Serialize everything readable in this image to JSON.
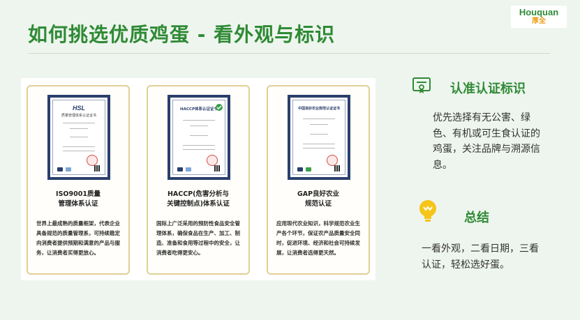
{
  "header": {
    "title": "如何挑选优质鸡蛋 - 看外观与标识",
    "logo_en": "Houquan",
    "logo_cn": "厚全"
  },
  "cards": [
    {
      "cert_logo": "HSL",
      "cert_heading": "质量管理体系认证证书",
      "title": "ISO9001质量\n管理体系认证",
      "desc": "世界上最成熟的质量框架，代表企业具备规范的质量管理系，可持续稳定向消费者提供预期和满意的产品与服务，让消费者买得更放心。"
    },
    {
      "cert_logo": "",
      "cert_heading": "HACCP体系认证证书",
      "title": "HACCP(危害分析与\n关键控制点)体系认证",
      "desc": "国际上广泛采用的预防性食品安全管理体系，确保食品在生产、加工、制造、准备和食用等过程中的安全，让消费者吃得更安心。"
    },
    {
      "cert_logo": "",
      "cert_heading": "中国良好农业规范认证证书",
      "title": "GAP良好农业\n规范认证",
      "desc": "应用现代农业知识，科学规范农业生产各个环节，保证农产品质量安全同时，促进环境、经济和社会可持续发展，让消费者选得更天然。"
    }
  ],
  "sections": [
    {
      "icon": "certificate-icon",
      "title": "认准认证标识",
      "text": "优先选择有无公害、绿色、有机或可生食认证的鸡蛋，关注品牌与溯源信息。"
    },
    {
      "icon": "lightbulb-icon",
      "title": "总结",
      "text": "一看外观，二看日期，三看认证，轻松选好蛋。"
    }
  ],
  "colors": {
    "accent_green": "#2f8a35",
    "background": "#eef5ee",
    "card_border": "#e2cf95",
    "bulb_yellow": "#f5c518",
    "cert_frame_blue": "#2a3f6b"
  }
}
